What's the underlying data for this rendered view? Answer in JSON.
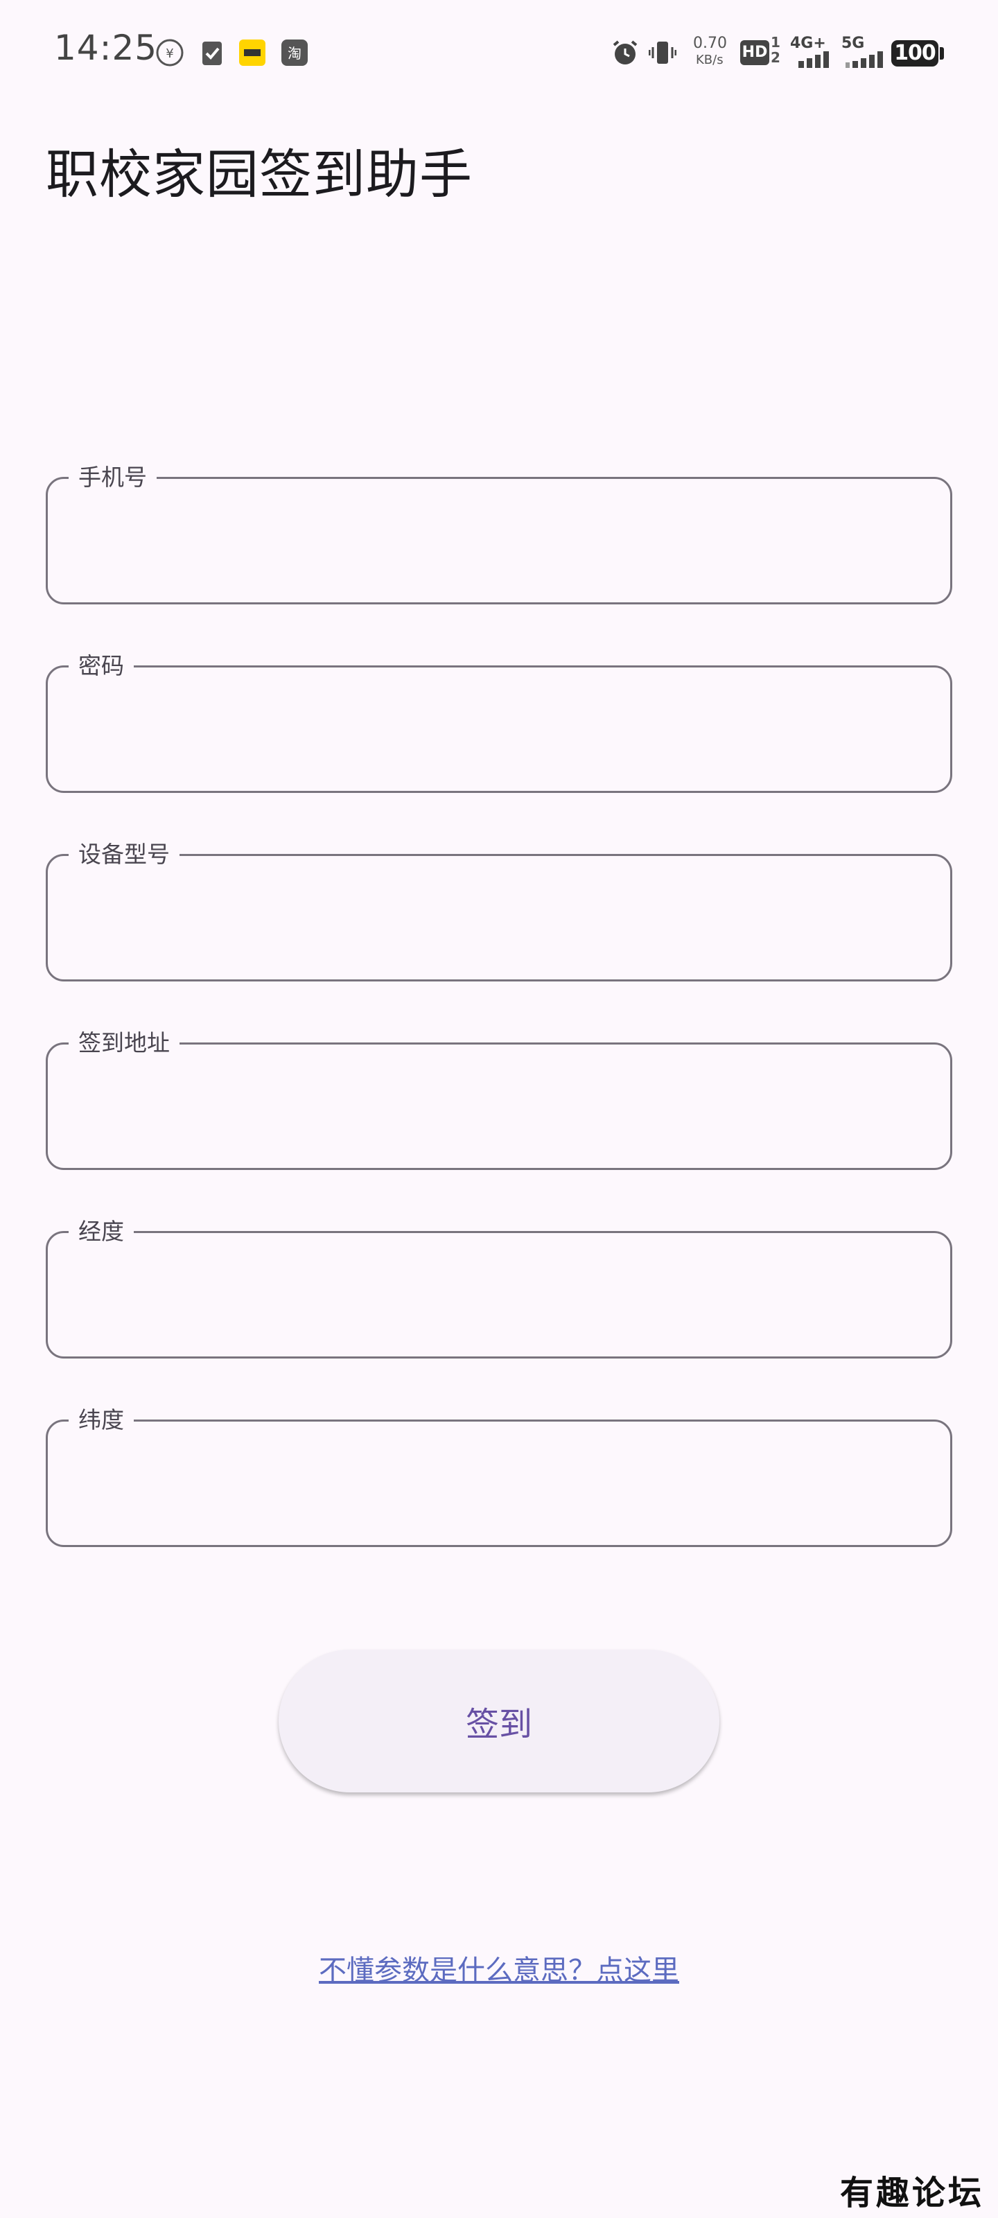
{
  "status_bar": {
    "time": "14:25",
    "net_speed_value": "0.70",
    "net_speed_unit": "KB/s",
    "hd_label": "HD",
    "sim_label": "1 2",
    "network_4g": "4G+",
    "network_5g": "5G",
    "battery": "100",
    "left_icons": [
      "unionpay-icon",
      "task-check-icon",
      "meituan-icon",
      "taobao-icon"
    ],
    "right_icons": [
      "alarm-icon",
      "vibrate-icon",
      "signal-icon"
    ]
  },
  "app": {
    "title": "职校家园签到助手"
  },
  "form": {
    "phone_label": "手机号",
    "password_label": "密码",
    "device_label": "设备型号",
    "address_label": "签到地址",
    "longitude_label": "经度",
    "latitude_label": "纬度"
  },
  "actions": {
    "signin_label": "签到",
    "help_link": "不懂参数是什么意思？点这里"
  },
  "watermark": "有趣论坛",
  "colors": {
    "background": "#fdf8fd",
    "accent": "#6750a4",
    "link": "#5c6bc0",
    "outline": "#79747e"
  }
}
